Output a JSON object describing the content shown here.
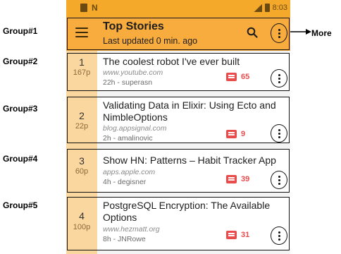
{
  "status_bar": {
    "time": "8:03",
    "network": "LTE"
  },
  "app_bar": {
    "title": "Top Stories",
    "subtitle": "Last updated 0 min. ago",
    "menu_icon": "hamburger-menu-icon",
    "search_icon": "search-icon",
    "more_icon": "more-vert-icon"
  },
  "annotations": {
    "groups": [
      "Group#1",
      "Group#2",
      "Group#3",
      "Group#4",
      "Group#5"
    ],
    "more_label": "More"
  },
  "stories": [
    {
      "rank": "1",
      "points": "167p",
      "title": "The coolest robot I've ever built",
      "domain": "www.youtube.com",
      "meta": "22h - superasn",
      "comments": "65"
    },
    {
      "rank": "2",
      "points": "22p",
      "title": "Validating Data in Elixir: Using Ecto and NimbleOptions",
      "domain": "blog.appsignal.com",
      "meta": "2h - amalinovic",
      "comments": "9"
    },
    {
      "rank": "3",
      "points": "60p",
      "title": "Show HN: Patterns – Habit Tracker App",
      "domain": "apps.apple.com",
      "meta": "4h - degisner",
      "comments": "39"
    },
    {
      "rank": "4",
      "points": "100p",
      "title": "PostgreSQL Encryption: The Available Options",
      "domain": "www.hezmatt.org",
      "meta": "8h - JNRowe",
      "comments": "31"
    }
  ],
  "colors": {
    "app_bar": "#f9ac3e",
    "rank_strip": "#fbd7a0",
    "comment_accent": "#ea4b4b"
  }
}
